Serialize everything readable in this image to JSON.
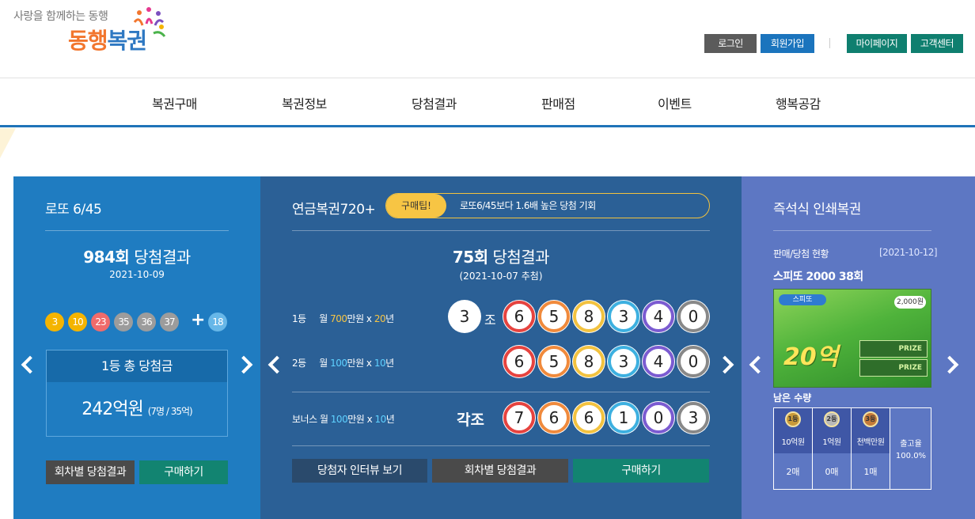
{
  "header": {
    "tagline": "사랑을 함께하는 동행",
    "logo_part1": "동행",
    "logo_part2": "복권",
    "util": {
      "login": "로그인",
      "join": "회원가입",
      "mypage": "마이페이지",
      "cs": "고객센터"
    }
  },
  "nav": [
    "복권구매",
    "복권정보",
    "당첨결과",
    "판매점",
    "이벤트",
    "행복공감"
  ],
  "lotto": {
    "title": "로또 6/45",
    "draw_no": "984회",
    "draw_label": "당첨결과",
    "date": "2021-10-09",
    "balls": [
      {
        "n": "3",
        "color": "#f4b400"
      },
      {
        "n": "10",
        "color": "#f4b400"
      },
      {
        "n": "23",
        "color": "#f06b6b"
      },
      {
        "n": "35",
        "color": "#9c9c9c"
      },
      {
        "n": "36",
        "color": "#9c9c9c"
      },
      {
        "n": "37",
        "color": "#9c9c9c"
      }
    ],
    "plus": "+",
    "bonus": {
      "n": "18",
      "color": "#67b7e8"
    },
    "prize_head": "1등 총 당첨금",
    "prize_amount": "242억원",
    "prize_detail": "(7명 / 35억)",
    "btn_history": "회차별 당첨결과",
    "btn_buy": "구매하기"
  },
  "pension": {
    "title": "연금복권720+",
    "tip_label": "구매팁!",
    "tip_text": "로또6/45보다 1.6배 높은 당첨 기회",
    "draw_no": "75회",
    "draw_label": "당첨결과",
    "date": "(2021-10-07 추첨)",
    "rank1": {
      "rank": "1등",
      "pre": "월 ",
      "amount": "700",
      "mid": "만원 x ",
      "years": "20",
      "post": "년",
      "group": "3",
      "jo": "조",
      "digits": [
        "6",
        "5",
        "8",
        "3",
        "4",
        "0"
      ]
    },
    "rank2": {
      "rank": "2등",
      "pre": "월 ",
      "amount": "100",
      "mid": "만원 x ",
      "years": "10",
      "post": "년",
      "digits": [
        "6",
        "5",
        "8",
        "3",
        "4",
        "0"
      ]
    },
    "bonus": {
      "rank": "보너스",
      "pre": " 월 ",
      "amount": "100",
      "mid": "만원 x ",
      "years": "10",
      "post": "년",
      "gakjo": "각조",
      "digits": [
        "7",
        "6",
        "6",
        "1",
        "0",
        "3"
      ]
    },
    "digit_colors": [
      "#e6433f",
      "#f08a3c",
      "#f2c23f",
      "#3db0e0",
      "#7b5bd1",
      "#888888"
    ],
    "btn_interview": "당첨자 인터뷰 보기",
    "btn_history": "회차별 당첨결과",
    "btn_buy": "구매하기"
  },
  "instant": {
    "title": "즉석식 인쇄복권",
    "status_label": "판매/당첨 현황",
    "status_date": "[2021-10-12]",
    "game_name": "스피또 2000 38회",
    "ticket": {
      "logo": "스피또",
      "price": "2,000원",
      "big": "20억",
      "prize1": "PRIZE",
      "prize2": "PRIZE"
    },
    "remaining_title": "남은 수량",
    "tiers": [
      {
        "badge": "1등",
        "name": "10억원",
        "count": "2매"
      },
      {
        "badge": "2등",
        "name": "1억원",
        "count": "0매"
      },
      {
        "badge": "3등",
        "name": "천백만원",
        "count": "1매"
      }
    ],
    "release_label": "출고율",
    "release_rate": "100.0%"
  }
}
